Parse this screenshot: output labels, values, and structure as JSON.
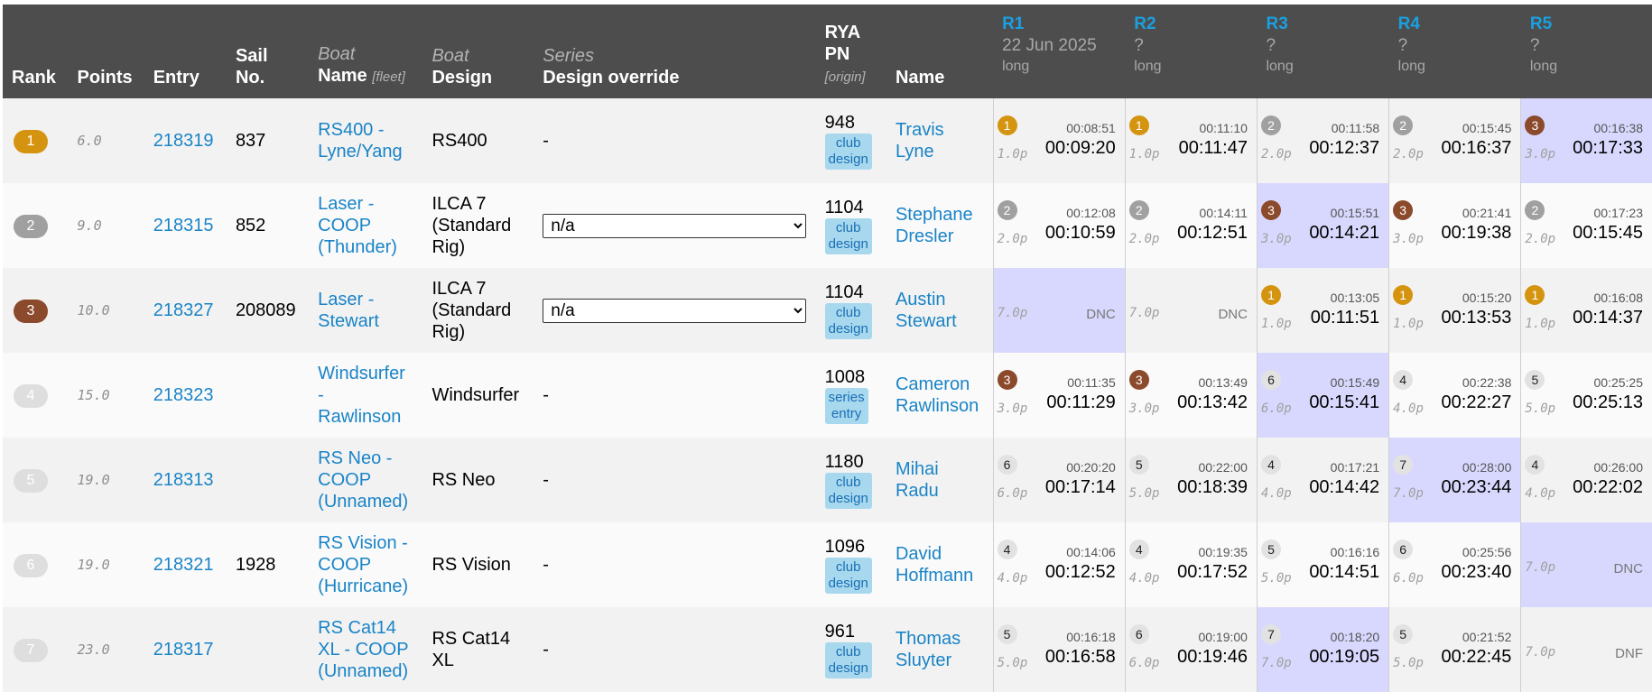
{
  "headers": {
    "rank": "Rank",
    "points": "Points",
    "entry": "Entry",
    "sail_no_1": "Sail",
    "sail_no_2": "No.",
    "boat_name_1": "Boat",
    "boat_name_2": "Name",
    "boat_name_sub": "[fleet]",
    "boat_design_1": "Boat",
    "boat_design_2": "Design",
    "series_1": "Series",
    "series_2": "Design override",
    "pn_1": "RYA",
    "pn_2": "PN",
    "pn_sub": "[origin]",
    "name": "Name",
    "races": [
      {
        "label": "R1",
        "date": "22 Jun 2025",
        "type": "long"
      },
      {
        "label": "R2",
        "date": "?",
        "type": "long"
      },
      {
        "label": "R3",
        "date": "?",
        "type": "long"
      },
      {
        "label": "R4",
        "date": "?",
        "type": "long"
      },
      {
        "label": "R5",
        "date": "?",
        "type": "long"
      }
    ]
  },
  "rows": [
    {
      "rank": "1",
      "points": "6.0",
      "entry": "218319",
      "sail": "837",
      "boat": [
        "RS400 -",
        "Lyne/Yang"
      ],
      "design": [
        "RS400"
      ],
      "override": "-",
      "pn": "948",
      "origin": [
        "club",
        "design"
      ],
      "helm": [
        "Travis",
        "Lyne"
      ],
      "races": [
        {
          "pos": "1",
          "pts": "1.0p",
          "elapsed": "00:08:51",
          "corrected": "00:09:20"
        },
        {
          "pos": "1",
          "pts": "1.0p",
          "elapsed": "00:11:10",
          "corrected": "00:11:47"
        },
        {
          "pos": "2",
          "pts": "2.0p",
          "elapsed": "00:11:58",
          "corrected": "00:12:37"
        },
        {
          "pos": "2",
          "pts": "2.0p",
          "elapsed": "00:15:45",
          "corrected": "00:16:37"
        },
        {
          "pos": "3",
          "pts": "3.0p",
          "elapsed": "00:16:38",
          "corrected": "00:17:33"
        }
      ]
    },
    {
      "rank": "2",
      "points": "9.0",
      "entry": "218315",
      "sail": "852",
      "boat": [
        "Laser -",
        "COOP",
        "(Thunder)"
      ],
      "design": [
        "ILCA 7",
        "(Standard",
        "Rig)"
      ],
      "override": "n/a",
      "pn": "1104",
      "origin": [
        "club",
        "design"
      ],
      "helm": [
        "Stephane",
        "Dresler"
      ],
      "races": [
        {
          "pos": "2",
          "pts": "2.0p",
          "elapsed": "00:12:08",
          "corrected": "00:10:59"
        },
        {
          "pos": "2",
          "pts": "2.0p",
          "elapsed": "00:14:11",
          "corrected": "00:12:51"
        },
        {
          "pos": "3",
          "pts": "3.0p",
          "elapsed": "00:15:51",
          "corrected": "00:14:21"
        },
        {
          "pos": "3",
          "pts": "3.0p",
          "elapsed": "00:21:41",
          "corrected": "00:19:38"
        },
        {
          "pos": "2",
          "pts": "2.0p",
          "elapsed": "00:17:23",
          "corrected": "00:15:45"
        }
      ]
    },
    {
      "rank": "3",
      "points": "10.0",
      "entry": "218327",
      "sail": "208089",
      "boat": [
        "Laser -",
        "Stewart"
      ],
      "design": [
        "ILCA 7",
        "(Standard",
        "Rig)"
      ],
      "override": "n/a",
      "pn": "1104",
      "origin": [
        "club",
        "design"
      ],
      "helm": [
        "Austin",
        "Stewart"
      ],
      "races": [
        {
          "pos": "",
          "pts": "7.0p",
          "code": "DNC"
        },
        {
          "pos": "",
          "pts": "7.0p",
          "code": "DNC"
        },
        {
          "pos": "1",
          "pts": "1.0p",
          "elapsed": "00:13:05",
          "corrected": "00:11:51"
        },
        {
          "pos": "1",
          "pts": "1.0p",
          "elapsed": "00:15:20",
          "corrected": "00:13:53"
        },
        {
          "pos": "1",
          "pts": "1.0p",
          "elapsed": "00:16:08",
          "corrected": "00:14:37"
        }
      ]
    },
    {
      "rank": "4",
      "points": "15.0",
      "entry": "218323",
      "sail": "",
      "boat": [
        "Windsurfer",
        "-",
        "Rawlinson"
      ],
      "design": [
        "Windsurfer"
      ],
      "override": "-",
      "pn": "1008",
      "origin": [
        "series",
        "entry"
      ],
      "helm": [
        "Cameron",
        "Rawlinson"
      ],
      "races": [
        {
          "pos": "3",
          "pts": "3.0p",
          "elapsed": "00:11:35",
          "corrected": "00:11:29"
        },
        {
          "pos": "3",
          "pts": "3.0p",
          "elapsed": "00:13:49",
          "corrected": "00:13:42"
        },
        {
          "pos": "6",
          "pts": "6.0p",
          "elapsed": "00:15:49",
          "corrected": "00:15:41"
        },
        {
          "pos": "4",
          "pts": "4.0p",
          "elapsed": "00:22:38",
          "corrected": "00:22:27"
        },
        {
          "pos": "5",
          "pts": "5.0p",
          "elapsed": "00:25:25",
          "corrected": "00:25:13"
        }
      ]
    },
    {
      "rank": "5",
      "points": "19.0",
      "entry": "218313",
      "sail": "",
      "boat": [
        "RS Neo -",
        "COOP",
        "(Unnamed)"
      ],
      "design": [
        "RS Neo"
      ],
      "override": "-",
      "pn": "1180",
      "origin": [
        "club",
        "design"
      ],
      "helm": [
        "Mihai",
        "Radu"
      ],
      "races": [
        {
          "pos": "6",
          "pts": "6.0p",
          "elapsed": "00:20:20",
          "corrected": "00:17:14"
        },
        {
          "pos": "5",
          "pts": "5.0p",
          "elapsed": "00:22:00",
          "corrected": "00:18:39"
        },
        {
          "pos": "4",
          "pts": "4.0p",
          "elapsed": "00:17:21",
          "corrected": "00:14:42"
        },
        {
          "pos": "7",
          "pts": "7.0p",
          "elapsed": "00:28:00",
          "corrected": "00:23:44"
        },
        {
          "pos": "4",
          "pts": "4.0p",
          "elapsed": "00:26:00",
          "corrected": "00:22:02"
        }
      ]
    },
    {
      "rank": "6",
      "points": "19.0",
      "entry": "218321",
      "sail": "1928",
      "boat": [
        "RS Vision -",
        "COOP",
        "(Hurricane)"
      ],
      "design": [
        "RS Vision"
      ],
      "override": "-",
      "pn": "1096",
      "origin": [
        "club",
        "design"
      ],
      "helm": [
        "David",
        "Hoffmann"
      ],
      "races": [
        {
          "pos": "4",
          "pts": "4.0p",
          "elapsed": "00:14:06",
          "corrected": "00:12:52"
        },
        {
          "pos": "4",
          "pts": "4.0p",
          "elapsed": "00:19:35",
          "corrected": "00:17:52"
        },
        {
          "pos": "5",
          "pts": "5.0p",
          "elapsed": "00:16:16",
          "corrected": "00:14:51"
        },
        {
          "pos": "6",
          "pts": "6.0p",
          "elapsed": "00:25:56",
          "corrected": "00:23:40"
        },
        {
          "pos": "",
          "pts": "7.0p",
          "code": "DNC"
        }
      ]
    },
    {
      "rank": "7",
      "points": "23.0",
      "entry": "218317",
      "sail": "",
      "boat": [
        "RS Cat14",
        "XL - COOP",
        "(Unnamed)"
      ],
      "design": [
        "RS Cat14",
        "XL"
      ],
      "override": "-",
      "pn": "961",
      "origin": [
        "club",
        "design"
      ],
      "helm": [
        "Thomas",
        "Sluyter"
      ],
      "races": [
        {
          "pos": "5",
          "pts": "5.0p",
          "elapsed": "00:16:18",
          "corrected": "00:16:58"
        },
        {
          "pos": "6",
          "pts": "6.0p",
          "elapsed": "00:19:00",
          "corrected": "00:19:46"
        },
        {
          "pos": "7",
          "pts": "7.0p",
          "elapsed": "00:18:20",
          "corrected": "00:19:05"
        },
        {
          "pos": "5",
          "pts": "5.0p",
          "elapsed": "00:21:52",
          "corrected": "00:22:45"
        },
        {
          "pos": "",
          "pts": "7.0p",
          "code": "DNF"
        }
      ]
    }
  ],
  "highlight_color": "#d8d8ff",
  "link_color": "#1a84c7"
}
